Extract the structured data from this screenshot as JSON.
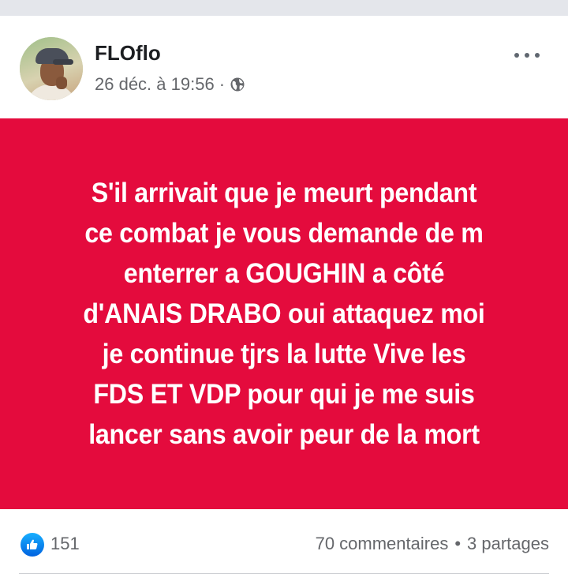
{
  "post": {
    "author": "FLOflo",
    "date": "26 déc. à 19:56",
    "separator": "·",
    "privacy_icon": "globe-icon",
    "more_icon": "more-options-icon",
    "text": "S'il arrivait que je meurt pendant\nce combat je vous demande de m\nenterrer a GOUGHIN a côté\nd'ANAIS DRABO oui attaquez moi\nje continue tjrs la lutte Vive les\nFDS ET VDP pour qui je me suis\nlancer sans avoir peur de la mort",
    "background_color": "#e40b3d",
    "text_color": "#ffffff"
  },
  "reactions": {
    "icon": "like-icon",
    "count": "151"
  },
  "stats": {
    "comments": "70 commentaires",
    "dot": "•",
    "shares": "3 partages"
  }
}
